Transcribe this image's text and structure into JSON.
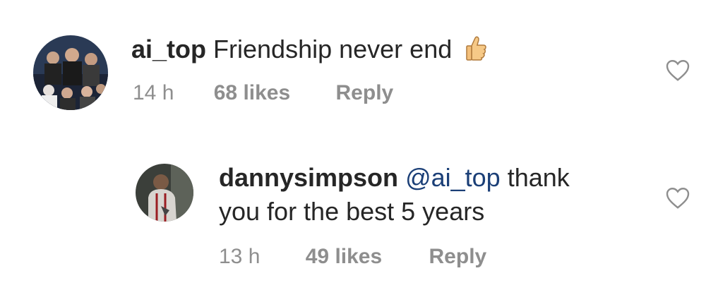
{
  "comment": {
    "username": "ai_top",
    "text": "Friendship never end",
    "emoji": "👍",
    "emoji_name": "thumbs-up-icon",
    "time": "14 h",
    "likes": "68 likes",
    "reply_label": "Reply"
  },
  "reply": {
    "username": "dannysimpson",
    "mention": "@ai_top",
    "text_line1": "thank",
    "text_line2": "you for the best 5 years",
    "time": "13 h",
    "likes": "49 likes",
    "reply_label": "Reply"
  },
  "colors": {
    "text": "#262626",
    "muted": "#8e8e8e",
    "mention": "#1b3f77"
  }
}
